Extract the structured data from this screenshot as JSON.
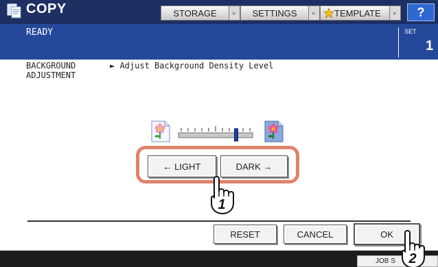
{
  "header": {
    "title": "COPY",
    "buttons": [
      {
        "label": "STORAGE"
      },
      {
        "label": "SETTINGS"
      },
      {
        "label": "TEMPLATE"
      }
    ],
    "help_label": "?"
  },
  "status": {
    "text": "READY",
    "set_label": "SET",
    "set_count": "1"
  },
  "content": {
    "section_label": "BACKGROUND ADJUSTMENT",
    "description": "► Adjust Background Density Level",
    "density_level": 0.8,
    "light_button": "← LIGHT",
    "dark_button": "DARK →"
  },
  "actions": {
    "reset": "RESET",
    "cancel": "CANCEL",
    "ok": "OK"
  },
  "footer": {
    "job_tab": "JOB S"
  },
  "callouts": [
    "1",
    "2"
  ],
  "colors": {
    "topbar": "#1e2f63",
    "statusbar": "#25499a",
    "highlight": "#e0836a",
    "help": "#2f69d0"
  }
}
